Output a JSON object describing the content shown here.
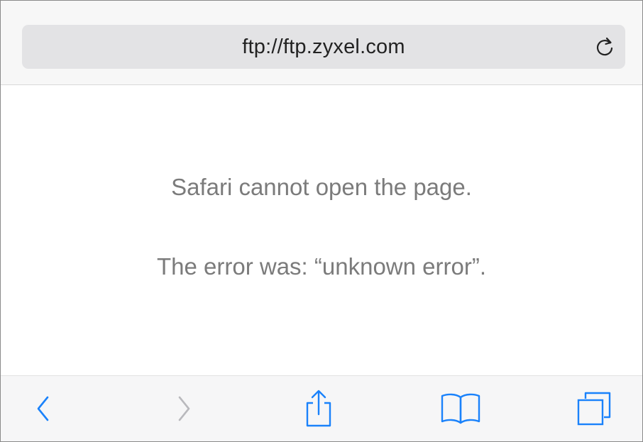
{
  "address_bar": {
    "url": "ftp://ftp.zyxel.com",
    "reload_icon": "reload-icon"
  },
  "error": {
    "title": "Safari cannot open the page.",
    "detail": "The error was: “unknown error”."
  },
  "toolbar": {
    "buttons": [
      {
        "icon": "back-icon",
        "enabled": true
      },
      {
        "icon": "forward-icon",
        "enabled": false
      },
      {
        "icon": "share-icon",
        "enabled": true
      },
      {
        "icon": "bookmarks-icon",
        "enabled": true
      },
      {
        "icon": "tabs-icon",
        "enabled": true
      }
    ]
  },
  "colors": {
    "accent": "#1a82fb",
    "disabled": "#b9b9bd",
    "message_text": "#7b7b7b"
  }
}
